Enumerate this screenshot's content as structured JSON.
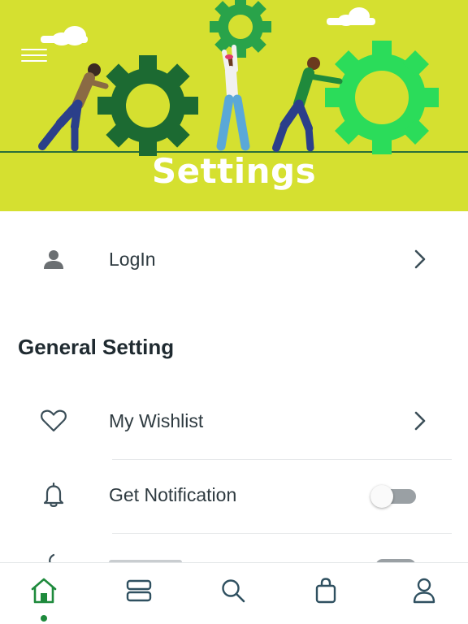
{
  "header": {
    "title": "Settings",
    "menu_icon": "hamburger-menu-icon",
    "background_color": "#d5e030",
    "illustration": "people-pushing-gears"
  },
  "account": {
    "login_label": "LogIn",
    "icon": "person-icon"
  },
  "general": {
    "section_title": "General Setting",
    "items": [
      {
        "label": "My Wishlist",
        "icon": "heart-icon",
        "control": "chevron"
      },
      {
        "label": "Get Notification",
        "icon": "bell-icon",
        "control": "toggle",
        "enabled": false
      }
    ],
    "partially_visible_item": {
      "icon": "moon-icon",
      "control": "toggle"
    }
  },
  "bottom_nav": {
    "items": [
      {
        "name": "home",
        "icon": "home-icon",
        "active": true
      },
      {
        "name": "categories",
        "icon": "categories-icon",
        "active": false
      },
      {
        "name": "search",
        "icon": "search-icon",
        "active": false
      },
      {
        "name": "cart",
        "icon": "shopping-bag-icon",
        "active": false
      },
      {
        "name": "profile",
        "icon": "user-icon",
        "active": false
      }
    ],
    "accent_color": "#1e8a3c",
    "inactive_color": "#2f5060"
  }
}
